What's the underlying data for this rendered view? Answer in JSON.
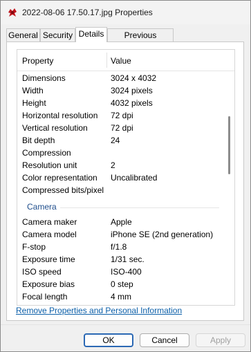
{
  "window": {
    "title": "2022-08-06 17.50.17.jpg Properties"
  },
  "tabs": [
    {
      "label": "General",
      "active": false
    },
    {
      "label": "Security",
      "active": false
    },
    {
      "label": "Details",
      "active": true
    },
    {
      "label": "Previous Versions",
      "active": false
    }
  ],
  "list": {
    "header": {
      "property": "Property",
      "value": "Value"
    },
    "image_rows": [
      {
        "property": "Dimensions",
        "value": "3024 x 4032"
      },
      {
        "property": "Width",
        "value": "3024 pixels"
      },
      {
        "property": "Height",
        "value": "4032 pixels"
      },
      {
        "property": "Horizontal resolution",
        "value": "72 dpi"
      },
      {
        "property": "Vertical resolution",
        "value": "72 dpi"
      },
      {
        "property": "Bit depth",
        "value": "24"
      },
      {
        "property": "Compression",
        "value": ""
      },
      {
        "property": "Resolution unit",
        "value": "2"
      },
      {
        "property": "Color representation",
        "value": "Uncalibrated"
      },
      {
        "property": "Compressed bits/pixel",
        "value": ""
      }
    ],
    "camera_group": "Camera",
    "camera_rows": [
      {
        "property": "Camera maker",
        "value": "Apple"
      },
      {
        "property": "Camera model",
        "value": "iPhone SE (2nd generation)"
      },
      {
        "property": "F-stop",
        "value": "f/1.8"
      },
      {
        "property": "Exposure time",
        "value": "1/31 sec."
      },
      {
        "property": "ISO speed",
        "value": "ISO-400"
      },
      {
        "property": "Exposure bias",
        "value": "0 step"
      },
      {
        "property": "Focal length",
        "value": "4 mm"
      }
    ]
  },
  "link_text": "Remove Properties and Personal Information",
  "buttons": {
    "ok": "OK",
    "cancel": "Cancel",
    "apply": "Apply"
  },
  "colors": {
    "accent": "#2b68b4",
    "link": "#0a5ea8",
    "group_label": "#1f4e8c"
  }
}
